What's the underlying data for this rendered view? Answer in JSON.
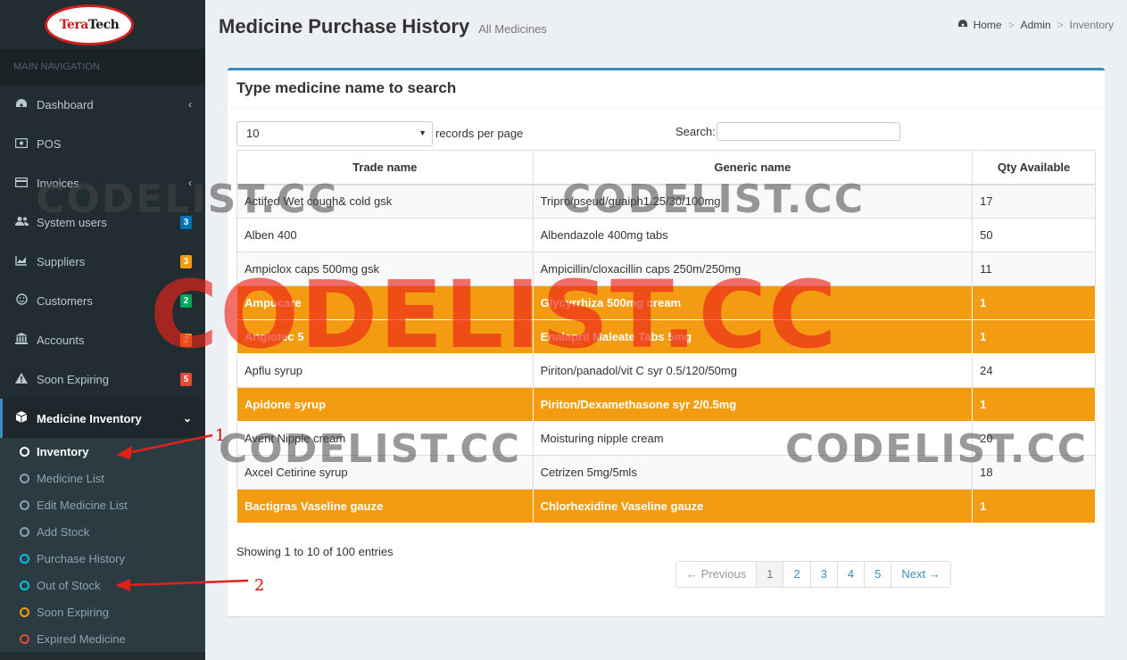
{
  "logo": {
    "text_a": "Tera",
    "text_b": "Tech"
  },
  "sidebar": {
    "header": "MAIN NAVIGATION",
    "items": [
      {
        "label": "Dashboard",
        "icon": "dashboard-icon",
        "chevron": "‹"
      },
      {
        "label": "POS",
        "icon": "pos-icon"
      },
      {
        "label": "Invoices",
        "icon": "invoice-icon",
        "chevron": "‹"
      },
      {
        "label": "System users",
        "icon": "users-icon",
        "badge": "3",
        "badge_color": "#0073b7"
      },
      {
        "label": "Suppliers",
        "icon": "chart-icon",
        "badge": "3",
        "badge_color": "#f39c12"
      },
      {
        "label": "Customers",
        "icon": "smiley-icon",
        "badge": "2",
        "badge_color": "#00a65a"
      },
      {
        "label": "Accounts",
        "icon": "bank-icon",
        "badge": "2",
        "badge_color": "#f39c12"
      },
      {
        "label": "Soon Expiring",
        "icon": "warning-icon",
        "badge": "5",
        "badge_color": "#dd4b39"
      },
      {
        "label": "Medicine Inventory",
        "icon": "cube-icon",
        "chevron": "⌄"
      }
    ],
    "submenu": [
      {
        "label": "Inventory",
        "color": "#ffffff"
      },
      {
        "label": "Medicine List",
        "color": "#8aa4af"
      },
      {
        "label": "Edit Medicine List",
        "color": "#8aa4af"
      },
      {
        "label": "Add Stock",
        "color": "#8aa4af"
      },
      {
        "label": "Purchase History",
        "color": "#00c0ef"
      },
      {
        "label": "Out of Stock",
        "color": "#00c0ef"
      },
      {
        "label": "Soon Expiring",
        "color": "#f39c12"
      },
      {
        "label": "Expired Medicine",
        "color": "#dd4b39"
      }
    ]
  },
  "header": {
    "title": "Medicine Purchase History",
    "subtitle": "All Medicines"
  },
  "breadcrumb": {
    "home": "Home",
    "admin": "Admin",
    "current": "Inventory"
  },
  "box": {
    "title": "Type medicine name to search"
  },
  "controls": {
    "page_length": "10",
    "length_label": "records per page",
    "search_label": "Search:"
  },
  "table": {
    "headers": [
      "Trade name",
      "Generic name",
      "Qty Available"
    ],
    "rows": [
      {
        "trade": "Actifed Wet cough& cold gsk",
        "generic": "Tripro/pseud/guaiph1.25/30/100mg",
        "qty": "17",
        "status": "normal"
      },
      {
        "trade": "Alben 400",
        "generic": "Albendazole 400mg tabs",
        "qty": "50",
        "status": "normal"
      },
      {
        "trade": "Ampiclox caps 500mg gsk",
        "generic": "Ampicillin/cloxacillin caps 250m/250mg",
        "qty": "11",
        "status": "normal"
      },
      {
        "trade": "Ampucare",
        "generic": "Glycyrrhiza 500mg cream",
        "qty": "1",
        "status": "low"
      },
      {
        "trade": "Angiotec 5",
        "generic": "Enalapril Maleate Tabs 5mg",
        "qty": "1",
        "status": "low"
      },
      {
        "trade": "Apflu syrup",
        "generic": "Piriton/panadol/vit C syr 0.5/120/50mg",
        "qty": "24",
        "status": "normal"
      },
      {
        "trade": "Apidone syrup",
        "generic": "Piriton/Dexamethasone syr 2/0.5mg",
        "qty": "1",
        "status": "low"
      },
      {
        "trade": "Avent Nipple cream",
        "generic": "Moisturing nipple cream",
        "qty": "20",
        "status": "normal"
      },
      {
        "trade": "Axcel Cetirine syrup",
        "generic": "Cetrizen 5mg/5mls",
        "qty": "18",
        "status": "normal"
      },
      {
        "trade": "Bactigras Vaseline gauze",
        "generic": "Chlorhexidine Vaseline gauze",
        "qty": "1",
        "status": "low"
      }
    ]
  },
  "footer": {
    "info": "Showing 1 to 10 of 100 entries"
  },
  "pagination": {
    "prev": "← Previous",
    "pages": [
      "1",
      "2",
      "3",
      "4",
      "5"
    ],
    "next": "Next →",
    "current": "1"
  },
  "watermark": "CODELIST.CC",
  "annotations": {
    "one": "1",
    "two": "2"
  }
}
